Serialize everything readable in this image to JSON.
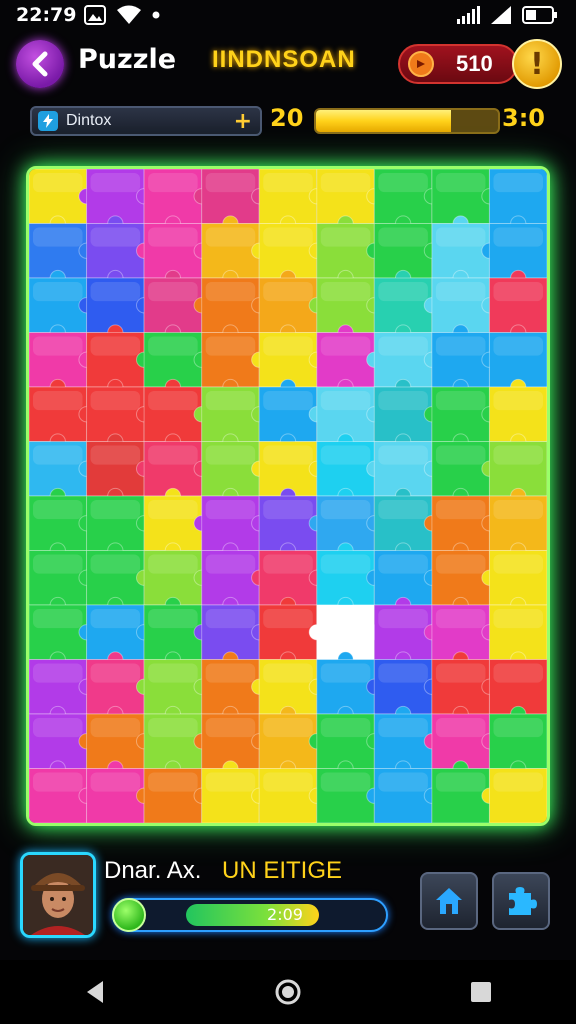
{
  "status_bar": {
    "time": "22:79",
    "icons": [
      "photo-icon",
      "wifi-icon",
      "dot-icon",
      "signal-icon",
      "signal-icon",
      "battery-icon"
    ]
  },
  "header": {
    "title": "Puzzle",
    "level_name": "IINDNSOAN",
    "coins": "510",
    "alert_symbol": "!"
  },
  "sub_bar": {
    "bonus_label": "Dintox",
    "bonus_plus": "+",
    "progress_left": "20",
    "progress_right": "3:0",
    "progress_fraction": 0.74
  },
  "board": {
    "cols": 9,
    "rows": 12,
    "colors": [
      [
        "#f4e21a",
        "#b23be8",
        "#f03aa8",
        "#e23b8a",
        "#f4e21a",
        "#f4e21a",
        "#28d04a",
        "#28d04a",
        "#1ea8f0"
      ],
      [
        "#2f7bf0",
        "#7a4cf0",
        "#f03aa8",
        "#f4b81a",
        "#f4e21a",
        "#8ade3a",
        "#28d04a",
        "#5ad6f0",
        "#1ea8f0"
      ],
      [
        "#1ea8f0",
        "#2f5cf0",
        "#e23b8a",
        "#f07a1a",
        "#f4a81a",
        "#8ade3a",
        "#28d0b0",
        "#5ad6f0",
        "#f03a5a"
      ],
      [
        "#f03aa8",
        "#f03a3a",
        "#28d04a",
        "#f07a1a",
        "#f4e21a",
        "#e23bc8",
        "#5ad6f0",
        "#1ea8f0",
        "#1ea8f0"
      ],
      [
        "#f03a3a",
        "#f03a3a",
        "#f03a3a",
        "#8ade3a",
        "#1ea8f0",
        "#5ad6f0",
        "#28c0c8",
        "#28d04a",
        "#f4e21a"
      ],
      [
        "#2fb8f0",
        "#e23b3a",
        "#f03a6a",
        "#8ade3a",
        "#f4e21a",
        "#1ed0f0",
        "#5ad6f0",
        "#28d04a",
        "#8ade3a"
      ],
      [
        "#28d04a",
        "#28d04a",
        "#f4e21a",
        "#b23be8",
        "#7a4cf0",
        "#2fa8f0",
        "#28c0c8",
        "#f07a1a",
        "#f4b81a"
      ],
      [
        "#28d04a",
        "#28d04a",
        "#8ade3a",
        "#b23be8",
        "#f03a6a",
        "#1ed0f0",
        "#1ea8f0",
        "#f07a1a",
        "#f4e21a"
      ],
      [
        "#28d04a",
        "#1ea8f0",
        "#28d04a",
        "#7a4cf0",
        "#f03a3a",
        "#ffffff",
        "#b23be8",
        "#e23bc8",
        "#f4e21a"
      ],
      [
        "#b23be8",
        "#f03a8a",
        "#8ade3a",
        "#f07a1a",
        "#f4e21a",
        "#1ea8f0",
        "#2f5cf0",
        "#f03a3a",
        "#f03a3a"
      ],
      [
        "#b23be8",
        "#f07a1a",
        "#8ade3a",
        "#f07a1a",
        "#f4b81a",
        "#28d04a",
        "#1ea8f0",
        "#f03aa8",
        "#28d04a"
      ],
      [
        "#f03aa8",
        "#f03aa8",
        "#f07a1a",
        "#f4e21a",
        "#f4e21a",
        "#28d04a",
        "#1ea8f0",
        "#28d04a",
        "#f4e21a"
      ]
    ]
  },
  "player": {
    "name": "Dnar. Ax.",
    "status": "UN EITIGE",
    "bar_text": "2:09",
    "bar_fraction": 0.68
  },
  "tools": {
    "left_icon": "home-icon",
    "right_icon": "puzzle-piece-icon"
  },
  "nav": {
    "icons": [
      "back-triangle-icon",
      "home-circle-icon",
      "recents-square-icon"
    ]
  }
}
